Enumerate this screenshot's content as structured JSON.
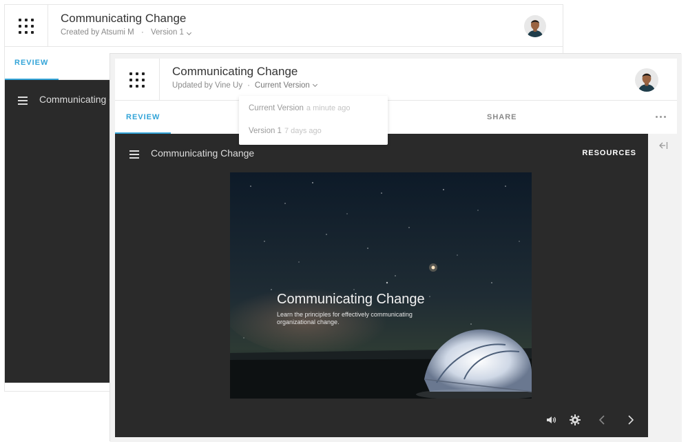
{
  "back_window": {
    "title": "Communicating Change",
    "created_by": "Created by Atsumi M",
    "separator": "·",
    "version": "Version 1",
    "tab_review": "REVIEW",
    "player_title": "Communicating C"
  },
  "front_window": {
    "title": "Communicating Change",
    "updated_by": "Updated by Vine Uy",
    "separator": "·",
    "version": "Current Version",
    "tabs": {
      "review": "REVIEW",
      "share": "SHARE"
    },
    "player": {
      "title": "Communicating Change",
      "resources": "RESOURCES",
      "slide_title": "Communicating Change",
      "slide_description": "Learn the principles for effectively communicating organizational change."
    },
    "controls": [
      "volume-icon",
      "gear-icon",
      "chevron-left-icon",
      "chevron-right-icon"
    ]
  },
  "version_dropdown": {
    "items": [
      {
        "label": "Current Version",
        "time": "a minute ago"
      },
      {
        "label": "Version 1",
        "time": "7 days ago"
      }
    ]
  },
  "colors": {
    "accent": "#33a4d8",
    "player_bg": "#2a2a2a",
    "panel_bg": "#f2f2f2"
  }
}
